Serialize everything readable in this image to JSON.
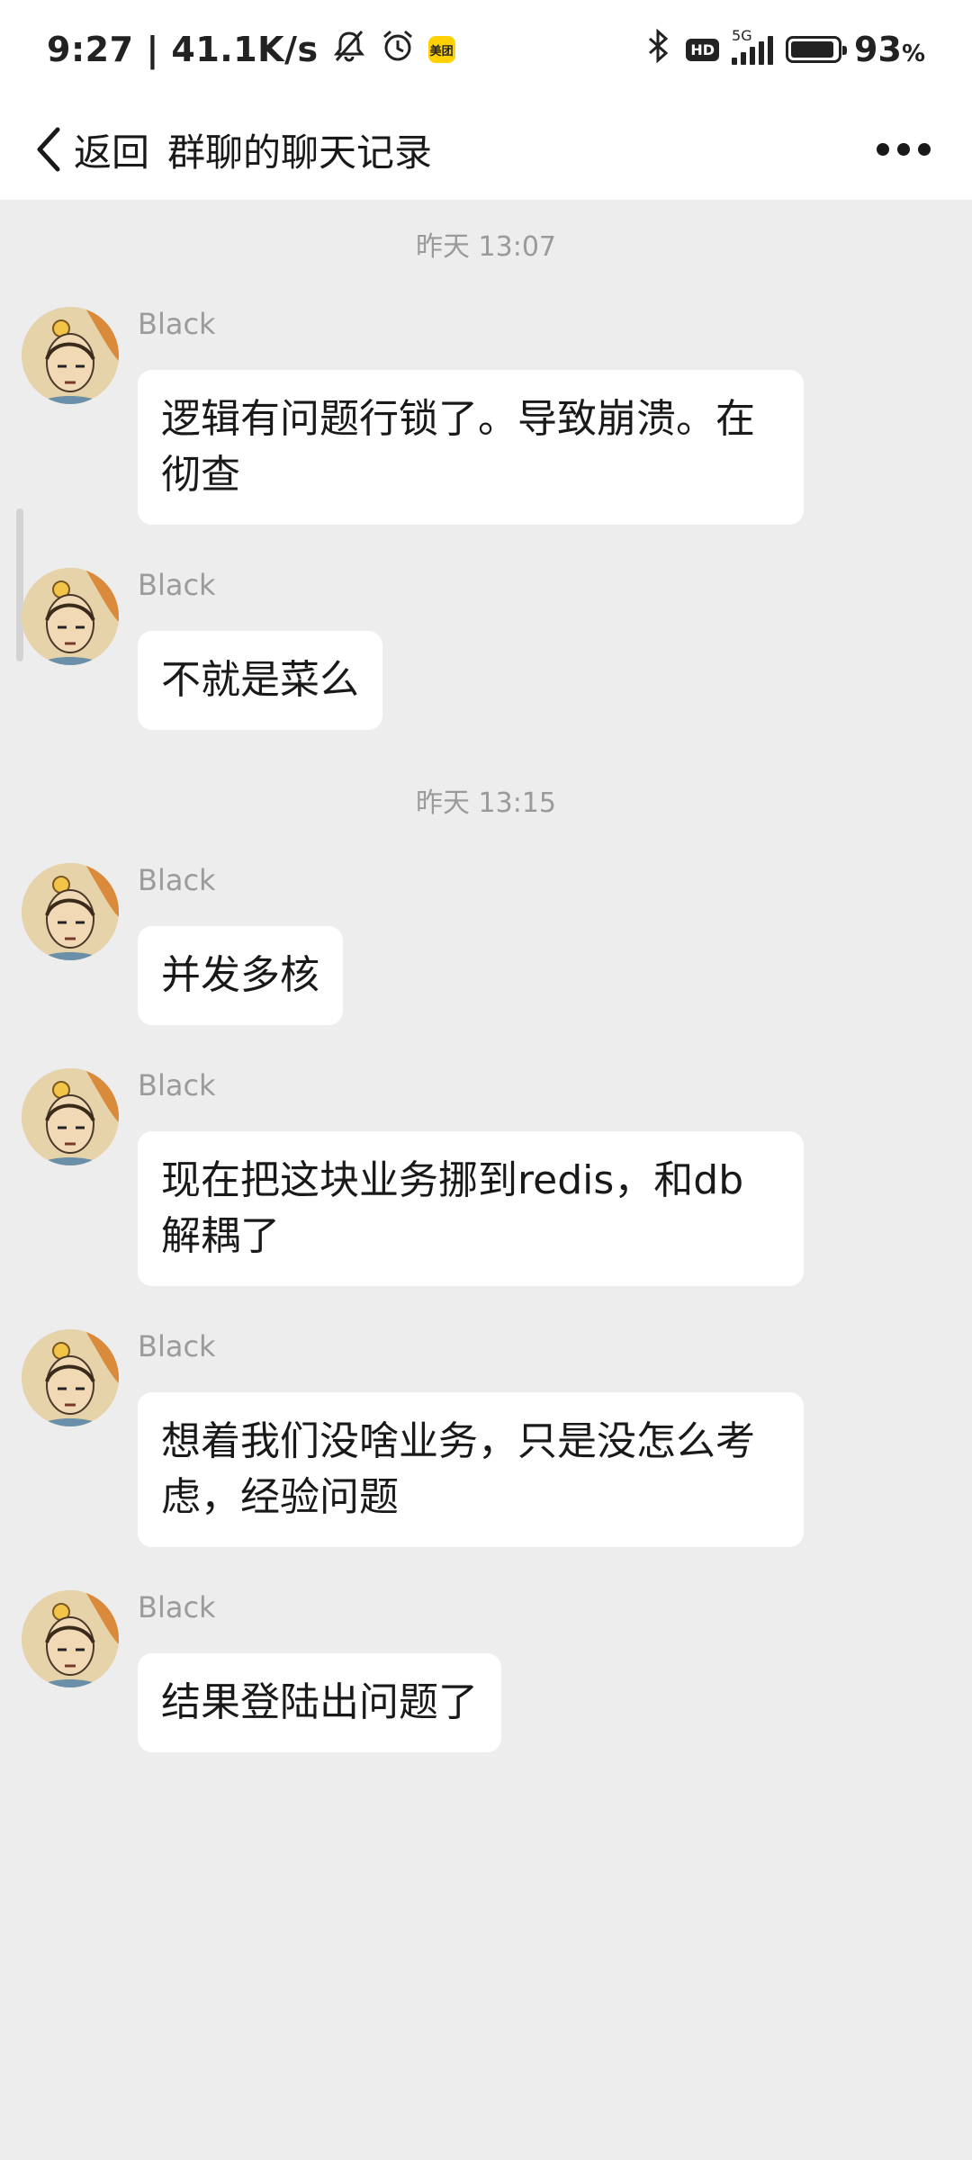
{
  "status_bar": {
    "time": "9:27",
    "speed": "41.1K/s",
    "app_badge": "美团",
    "network": "5G",
    "hd": "HD",
    "battery_percent": "93",
    "battery_unit": "%",
    "battery_level": 0.93,
    "icons": [
      "mute-icon",
      "alarm-icon",
      "bluetooth-icon",
      "signal-icon",
      "battery-icon"
    ]
  },
  "nav": {
    "back_label": "返回",
    "title": "群聊的聊天记录",
    "back_icon": "chevron-left-icon",
    "more_icon": "more-icon"
  },
  "colors": {
    "background": "#ededed",
    "bubble": "#ffffff",
    "text": "#191919",
    "secondary_text": "#9a9a9a"
  },
  "chat": {
    "timestamps": [
      "昨天 13:07",
      "昨天 13:15"
    ],
    "messages": [
      {
        "sender": "Black",
        "text": "逻辑有问题行锁了。导致崩溃。在彻查"
      },
      {
        "sender": "Black",
        "text": "不就是菜么"
      },
      {
        "sender": "Black",
        "text": "并发多核"
      },
      {
        "sender": "Black",
        "text": "现在把这块业务挪到redis，和db解耦了"
      },
      {
        "sender": "Black",
        "text": "想着我们没啥业务，只是没怎么考虑，经验问题"
      },
      {
        "sender": "Black",
        "text": "结果登陆出问题了"
      }
    ]
  }
}
